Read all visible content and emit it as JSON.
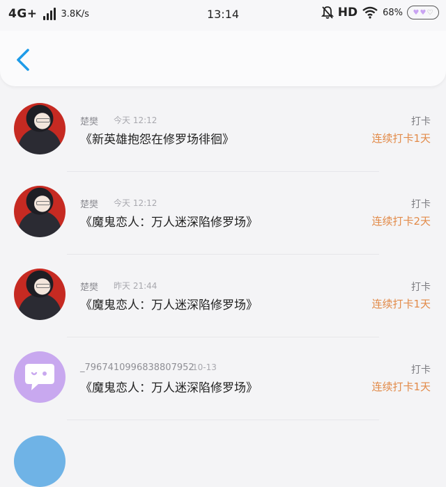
{
  "status": {
    "network": "4G+",
    "speed": "3.8K/s",
    "time": "13:14",
    "hd": "HD",
    "battery": "68%"
  },
  "entries": [
    {
      "username": "楚樊",
      "time": "今天 12:12",
      "title": "《新英雄抱怨在修罗场徘徊》",
      "action": "打卡",
      "streak": "连续打卡1天"
    },
    {
      "username": "楚樊",
      "time": "今天 12:12",
      "title": "《魔鬼恋人：万人迷深陷修罗场》",
      "action": "打卡",
      "streak": "连续打卡2天"
    },
    {
      "username": "楚樊",
      "time": "昨天 21:44",
      "title": "《魔鬼恋人：万人迷深陷修罗场》",
      "action": "打卡",
      "streak": "连续打卡1天"
    },
    {
      "username": "_7967410996838807952",
      "time": "10-13",
      "title": "《魔鬼恋人：万人迷深陷修罗场》",
      "action": "打卡",
      "streak": "连续打卡1天"
    }
  ],
  "colors": {
    "accent_blue": "#1e9be8",
    "streak_orange": "#e28a48"
  }
}
